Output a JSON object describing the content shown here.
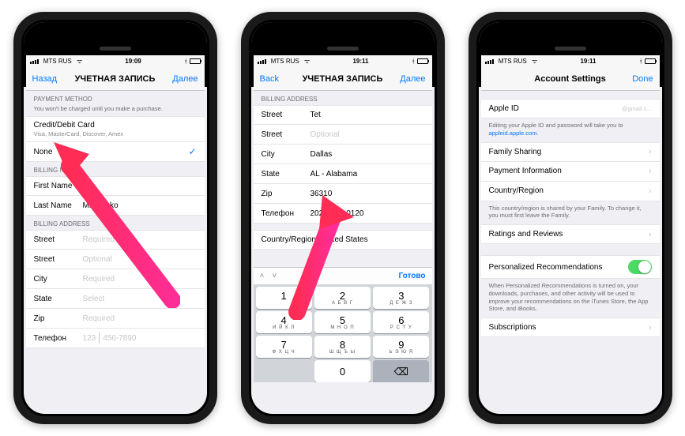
{
  "phone1": {
    "carrier": "MTS RUS",
    "time": "19:09",
    "nav": {
      "back": "Назад",
      "title": "УЧЕТНАЯ ЗАПИСЬ",
      "next": "Далее"
    },
    "payment": {
      "header": "PAYMENT METHOD",
      "note": "You won't be charged until you make a purchase.",
      "credit_title": "Credit/Debit Card",
      "credit_sub": "Visa, MasterCard, Discover, Amex",
      "none": "None"
    },
    "billing_name": {
      "header": "BILLING NAME",
      "first_label": "First Name",
      "first_value": "S          v",
      "last_label": "Last Name",
      "last_value": "Mikhay    ko"
    },
    "billing_addr": {
      "header": "BILLING ADDRESS",
      "street_label": "Street",
      "street_ph": "Required",
      "street2_label": "Street",
      "street2_ph": "Optional",
      "city_label": "City",
      "city_ph": "Required",
      "state_label": "State",
      "state_ph": "Select",
      "zip_label": "Zip",
      "zip_ph": "Required",
      "phone_label": "Телефон",
      "phone_code_ph": "123",
      "phone_num_ph": "456-7890"
    }
  },
  "phone2": {
    "carrier": "MTS RUS",
    "time": "19:11",
    "nav": {
      "back": "Back",
      "title": "УЧЕТНАЯ ЗАПИСЬ",
      "next": "Далее"
    },
    "billing_addr": {
      "header": "BILLING ADDRESS",
      "street_label": "Street",
      "street_value": "Tet",
      "street2_label": "Street",
      "street2_ph": "Optional",
      "city_label": "City",
      "city_value": "Dallas",
      "state_label": "State",
      "state_value": "AL - Alabama",
      "zip_label": "Zip",
      "zip_value": "36310",
      "phone_label": "Телефон",
      "phone_code": "202",
      "phone_num": "555-0120",
      "country_label": "Country/Region: United States"
    },
    "keyboard": {
      "done": "Готово",
      "k1": "1",
      "k2": "2",
      "k3": "3",
      "k4": "4",
      "k5": "5",
      "k6": "6",
      "k7": "7",
      "k8": "8",
      "k9": "9",
      "k0": "0",
      "l2": "А Б В Г",
      "l3": "Д Е Ж З",
      "l4": "И Й К Л",
      "l5": "М Н О П",
      "l6": "Р С Т У",
      "l7": "Ф Х Ц Ч",
      "l8": "Ш Щ Ъ Ы",
      "l9": "Ь Э Ю Я"
    }
  },
  "phone3": {
    "carrier": "MTS RUS",
    "time": "19:11",
    "nav": {
      "title": "Account Settings",
      "done": "Done"
    },
    "apple_id_label": "Apple ID",
    "apple_id_value": "@gmail.c...",
    "apple_id_note1": "Editing your Apple ID and password will take you to ",
    "apple_id_link": "appleid.apple.com",
    "family_sharing": "Family Sharing",
    "payment_info": "Payment Information",
    "country_region": "Country/Region",
    "country_note": "This country/region is shared by your Family. To change it, you must first leave the Family.",
    "ratings": "Ratings and Reviews",
    "personalized": "Personalized Recommendations",
    "personalized_note": "When Personalized Recommendations is turned on, your downloads, purchases, and other activity will be used to improve your recommendations on the iTunes Store, the App Store, and iBooks.",
    "subscriptions": "Subscriptions"
  }
}
